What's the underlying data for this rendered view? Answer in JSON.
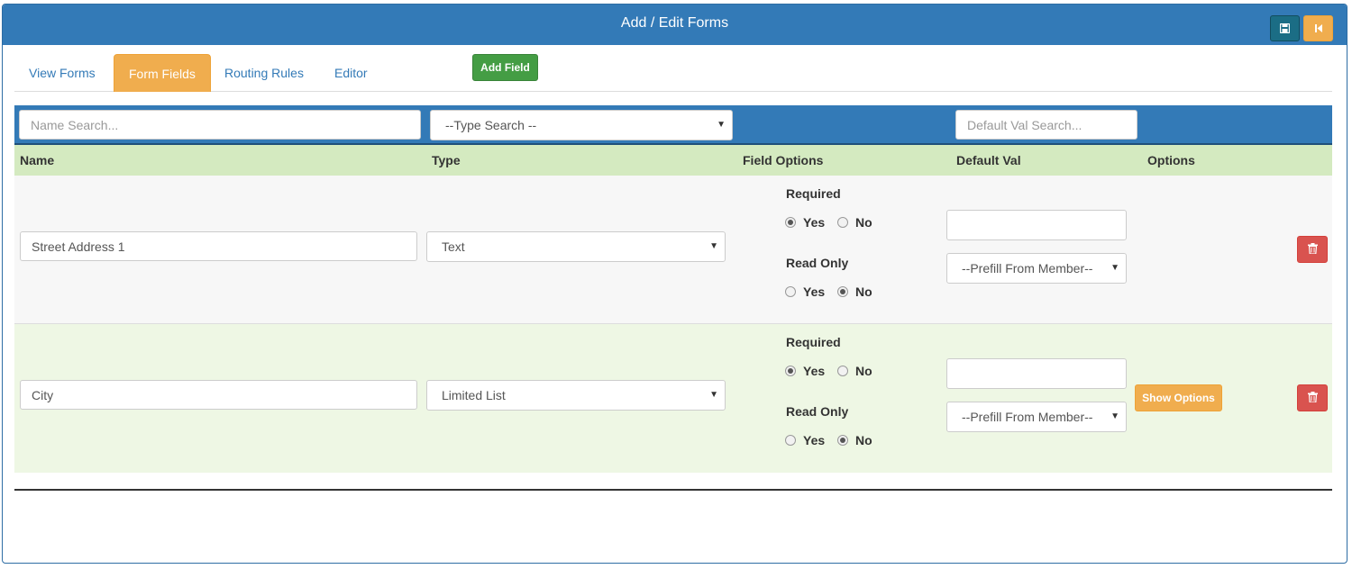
{
  "header": {
    "title": "Add / Edit Forms"
  },
  "tabs": [
    {
      "label": "View Forms"
    },
    {
      "label": "Form Fields",
      "active": true
    },
    {
      "label": "Routing Rules"
    },
    {
      "label": "Editor"
    }
  ],
  "add_field_label": "Add Field",
  "search": {
    "name_placeholder": "Name Search...",
    "type_value": "--Type Search --",
    "default_placeholder": "Default Val Search..."
  },
  "columns": {
    "name": "Name",
    "type": "Type",
    "field_options": "Field Options",
    "default_val": "Default Val",
    "options": "Options"
  },
  "labels": {
    "required": "Required",
    "read_only": "Read Only",
    "yes": "Yes",
    "no": "No"
  },
  "rows": [
    {
      "name": "Street Address 1",
      "type": "Text",
      "required": "Yes",
      "read_only": "No",
      "default_val": "",
      "prefill": "--Prefill From Member--"
    },
    {
      "name": "City",
      "type": "Limited List",
      "required": "Yes",
      "read_only": "No",
      "default_val": "",
      "prefill": "--Prefill From Member--",
      "show_options_label": "Show Options"
    }
  ],
  "icons": {
    "save": "save-icon",
    "back": "step-backward-icon",
    "delete": "trash-icon"
  },
  "colors": {
    "primary": "#337ab7",
    "warning": "#f0ad4e",
    "success": "#449d44",
    "danger": "#d9534f",
    "header_row": "#d4eac0"
  }
}
